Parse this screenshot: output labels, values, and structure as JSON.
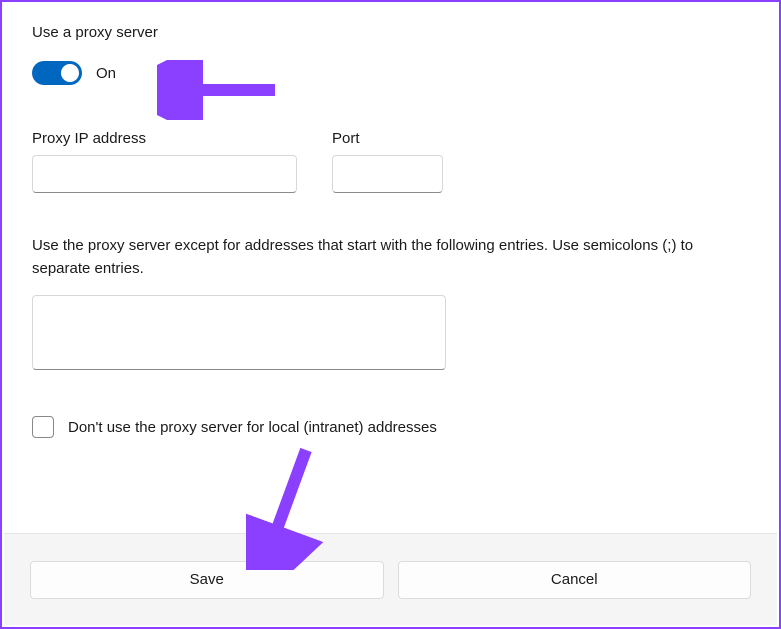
{
  "proxy": {
    "section_title": "Use a proxy server",
    "toggle_state_label": "On",
    "ip_label": "Proxy IP address",
    "ip_value": "",
    "port_label": "Port",
    "port_value": "",
    "exceptions_label": "Use the proxy server except for addresses that start with the following entries. Use semicolons (;) to separate entries.",
    "exceptions_value": "",
    "bypass_local_label": "Don't use the proxy server for local (intranet) addresses"
  },
  "buttons": {
    "save": "Save",
    "cancel": "Cancel"
  }
}
